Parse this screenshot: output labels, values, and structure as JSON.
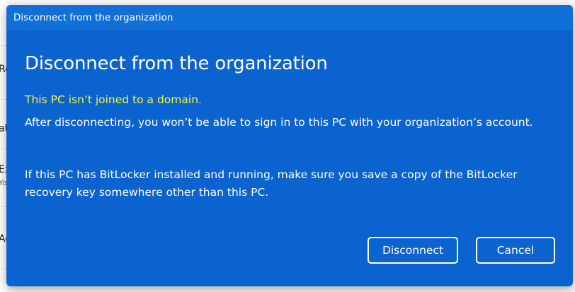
{
  "background": {
    "fragments": [
      "Re",
      "at",
      "Ex",
      "Yo",
      "Ac"
    ]
  },
  "dialog": {
    "window_title": "Disconnect from the organization",
    "heading": "Disconnect from the organization",
    "warning": "This PC isn’t joined to a domain.",
    "paragraph1": "After disconnecting, you won’t be able to sign in to this PC with your organization’s account.",
    "paragraph2": "If this PC has BitLocker installed and running, make sure you save a copy of the BitLocker recovery key somewhere other than this PC.",
    "disconnect_label": "Disconnect",
    "cancel_label": "Cancel"
  },
  "colors": {
    "dialog_bg": "#0b63cf",
    "titlebar_bg": "#1170d8",
    "warning_text": "#f8f53e",
    "text": "#ffffff"
  }
}
